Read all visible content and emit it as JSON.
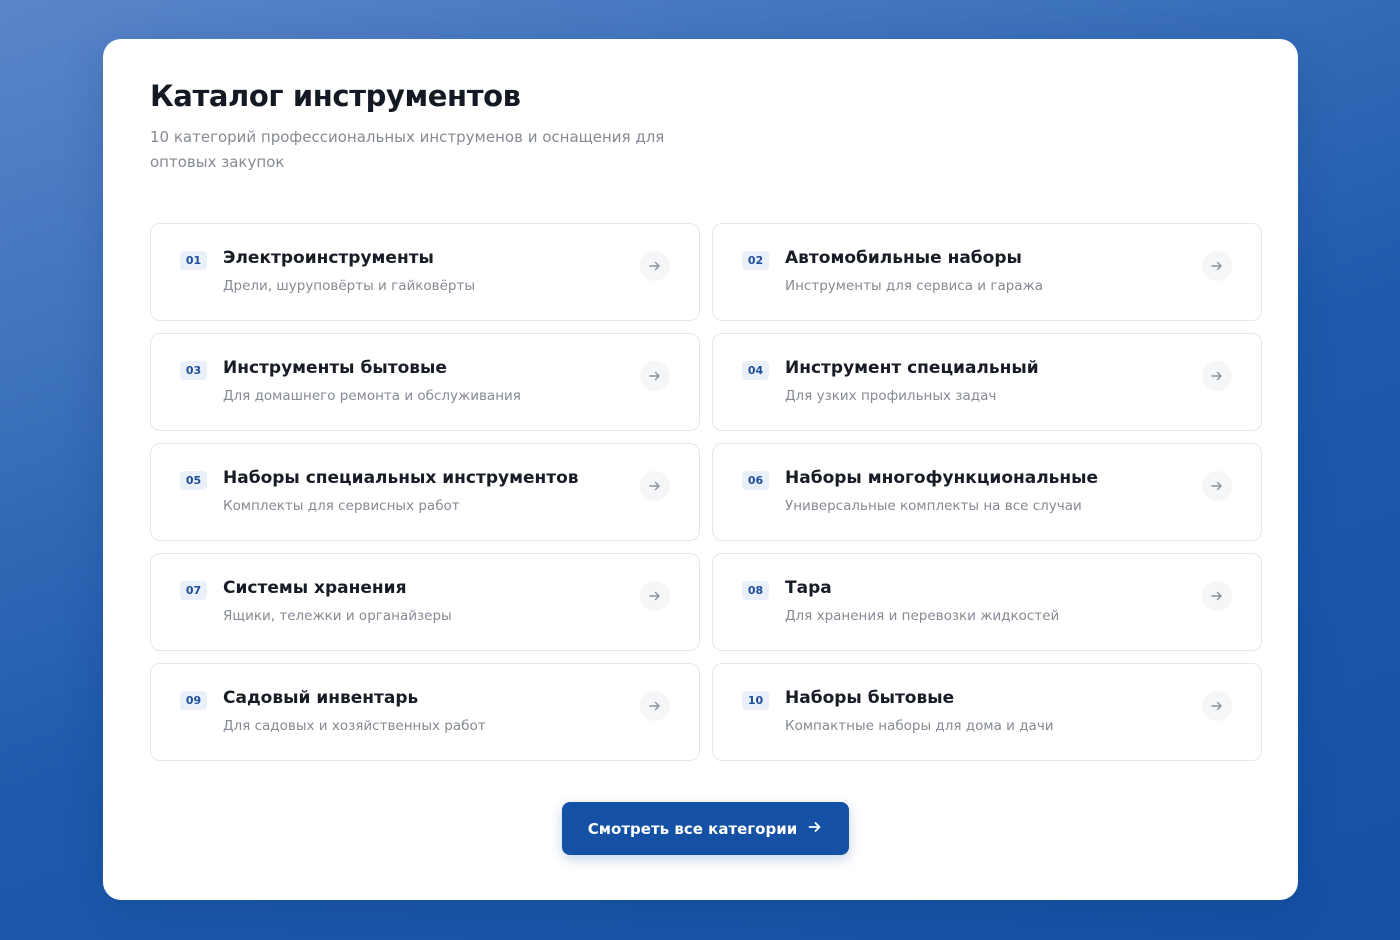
{
  "catalog": {
    "title": "Каталог инструментов",
    "subtitle": "10 категорий профессиональных инструменов и оснащения для оптовых закупок",
    "categories": [
      {
        "num": "01",
        "title": "Электроинструменты",
        "desc": "Дрели, шуруповёрты и гайковёрты"
      },
      {
        "num": "02",
        "title": "Автомобильные наборы",
        "desc": "Инструменты для сервиса и гаража"
      },
      {
        "num": "03",
        "title": "Инструменты бытовые",
        "desc": "Для домашнего ремонта и обслуживания"
      },
      {
        "num": "04",
        "title": "Инструмент специальный",
        "desc": "Для узких профильных задач"
      },
      {
        "num": "05",
        "title": "Наборы специальных инструментов",
        "desc": "Комплекты для сервисных работ"
      },
      {
        "num": "06",
        "title": "Наборы многофункциональные",
        "desc": "Универсальные комплекты на все случаи"
      },
      {
        "num": "07",
        "title": "Системы хранения",
        "desc": "Ящики, тележки и органайзеры"
      },
      {
        "num": "08",
        "title": "Тара",
        "desc": "Для хранения и перевозки жидкостей"
      },
      {
        "num": "09",
        "title": "Садовый инвентарь",
        "desc": "Для садовых и хозяйственных работ"
      },
      {
        "num": "10",
        "title": "Наборы бытовые",
        "desc": "Компактные наборы для дома и дачи"
      }
    ],
    "cta_label": "Смотреть все категории",
    "card_icon": "arrow-right-icon",
    "cta_icon": "arrow-right-icon"
  },
  "colors": {
    "accent": "#1450a3",
    "badge_bg": "#eaf0fa",
    "badge_text": "#1f4e99",
    "background_top": "#5a86c8",
    "background_bottom": "#1450a3"
  }
}
